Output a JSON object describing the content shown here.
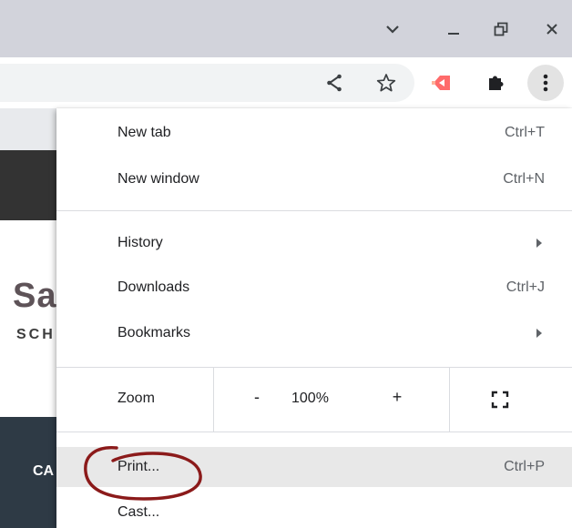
{
  "window_controls": {
    "tab_search": "chevron-down-icon",
    "minimize": "minimize-icon",
    "restore": "restore-icon",
    "close": "close-icon"
  },
  "toolbar": {
    "share": "share-icon",
    "bookmark": "star-icon",
    "extension_cast": "extension-logo-icon",
    "extensions": "puzzle-icon",
    "menu": "vertical-dots-icon"
  },
  "background_page": {
    "logo_text": "Sa",
    "logo_sub": "SCH",
    "cta_text": "CA"
  },
  "menu": {
    "items": [
      {
        "label": "New tab",
        "shortcut": "Ctrl+T"
      },
      {
        "label": "New window",
        "shortcut": "Ctrl+N"
      },
      {
        "label": "History",
        "shortcut": ""
      },
      {
        "label": "Downloads",
        "shortcut": "Ctrl+J"
      },
      {
        "label": "Bookmarks",
        "shortcut": ""
      },
      {
        "label": "Print...",
        "shortcut": "Ctrl+P"
      },
      {
        "label": "Cast...",
        "shortcut": ""
      }
    ],
    "zoom": {
      "label": "Zoom",
      "minus": "-",
      "value": "100%",
      "plus": "+"
    }
  },
  "colors": {
    "titlebar": "#d2d3db",
    "annotation": "#8b1a1a",
    "menu_highlight": "#e8e8e8"
  }
}
